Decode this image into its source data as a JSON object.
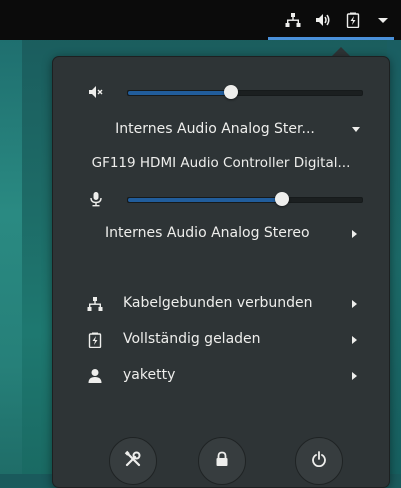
{
  "topbar": {
    "icons": [
      "network-wired-icon",
      "audio-volume-icon",
      "battery-charging-icon",
      "dropdown-arrow-icon"
    ]
  },
  "audio": {
    "output_level": 0.44,
    "output_device_label": "Internes Audio Analog Ster...",
    "hdmi_device_label": "GF119 HDMI Audio Controller Digital...",
    "input_level": 0.66,
    "input_device_label": "Internes Audio Analog Stereo"
  },
  "status_items": [
    {
      "icon": "network-wired-icon",
      "label": "Kabelgebunden verbunden"
    },
    {
      "icon": "battery-full-charged-icon",
      "label": "Vollständig geladen"
    },
    {
      "icon": "user-icon",
      "label": "yaketty"
    }
  ],
  "bottom_buttons": [
    {
      "icon": "settings-tools-icon"
    },
    {
      "icon": "lock-icon"
    },
    {
      "icon": "power-icon"
    }
  ],
  "colors": {
    "accent": "#4a90d9",
    "slider_fill": "#215d9c",
    "menu_bg": "#2e3436",
    "text": "#eeeeec"
  }
}
